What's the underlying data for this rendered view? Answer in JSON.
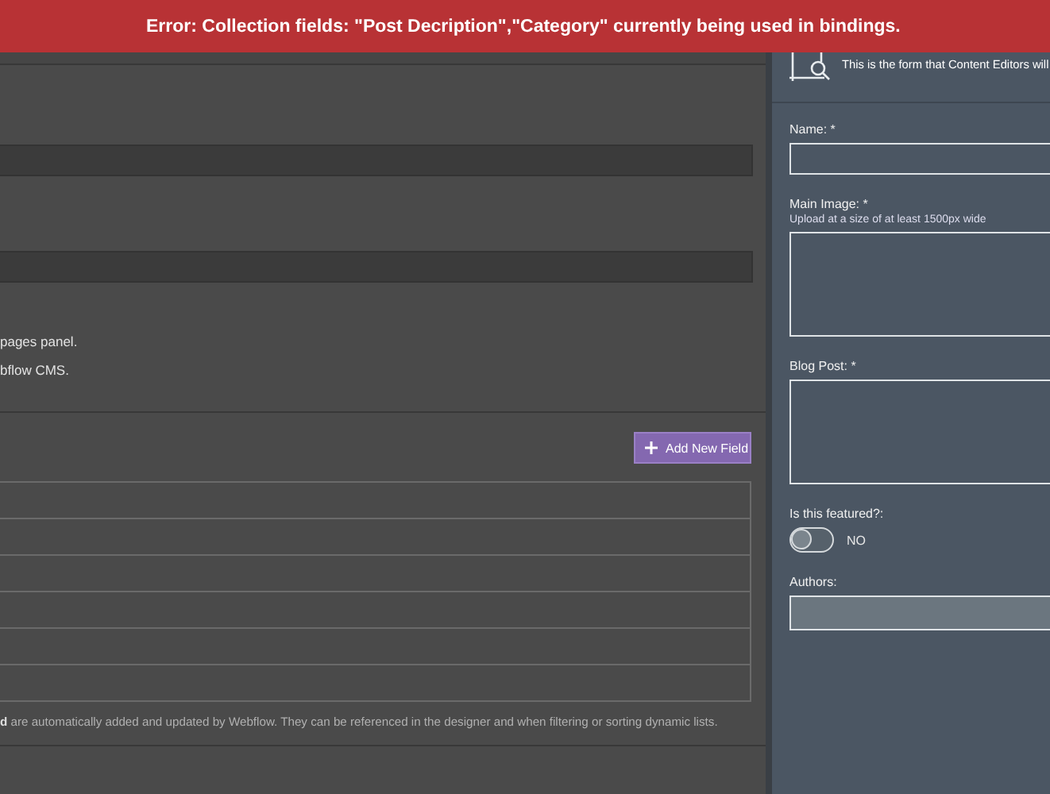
{
  "error_banner": {
    "message": "Error: Collection fields: \"Post Decription\",\"Category\" currently being used in bindings."
  },
  "collection_settings": {
    "inputs": [
      {
        "kind": "text-input"
      },
      {
        "kind": "text-input"
      }
    ],
    "notes": [
      "pages panel.",
      "bflow CMS."
    ]
  },
  "fields_section": {
    "add_button": "Add New Field",
    "rows": [
      {
        "kind": "field-row"
      },
      {
        "kind": "field-row"
      },
      {
        "kind": "field-row"
      },
      {
        "kind": "field-row"
      },
      {
        "kind": "field-row"
      },
      {
        "kind": "field-row"
      }
    ],
    "footer_note": "**d** are automatically added and updated by Webflow. They can be referenced in the designer and when filtering or sorting dynamic lists."
  },
  "cms_preview": {
    "subtitle": "This is the form that Content Editors will",
    "fields": [
      {
        "kind": "text",
        "label": "Name: *"
      },
      {
        "kind": "image",
        "label": "Main Image: *",
        "hint": "Upload at a size of at least 1500px wide"
      },
      {
        "kind": "richtext",
        "label": "Blog Post: *"
      },
      {
        "kind": "switch",
        "label": "Is this featured?:",
        "on": false,
        "state_label": "NO"
      },
      {
        "kind": "reference",
        "label": "Authors:"
      }
    ]
  }
}
